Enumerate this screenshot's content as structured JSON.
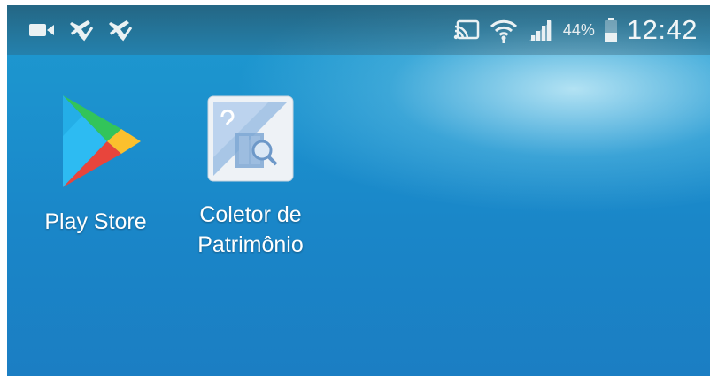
{
  "status_bar": {
    "left_icons": [
      "video-camera-icon",
      "airplane-check-icon",
      "airplane-check-icon"
    ],
    "right_icons": [
      "cast-icon",
      "wifi-icon",
      "signal-icon",
      "battery-icon"
    ],
    "battery_percent": "44%",
    "battery_level": 0.44,
    "time": "12:42"
  },
  "home_screen": {
    "apps": [
      {
        "label": "Play Store",
        "icon": "play-store-icon"
      },
      {
        "label": "Coletor de\nPatrimônio",
        "icon": "coletor-de-patrimonio-icon"
      }
    ]
  },
  "colors": {
    "wallpaper": "#1b8fcd",
    "status_bar_text": "#eef4f6"
  }
}
